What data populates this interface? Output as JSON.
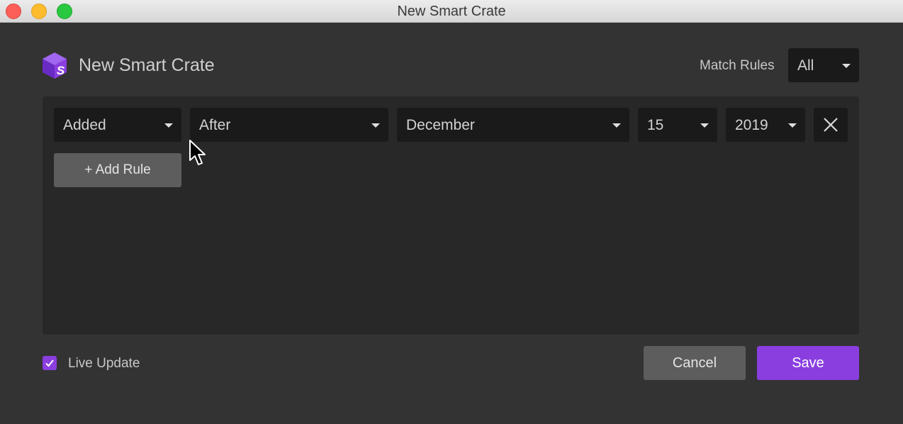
{
  "window": {
    "title": "New Smart Crate"
  },
  "header": {
    "title": "New Smart Crate",
    "logo_icon": "smart-crate-cube-icon",
    "match_rules_label": "Match Rules",
    "match_rules_value": "All"
  },
  "rule": {
    "field": "Added",
    "operator": "After",
    "month": "December",
    "day": "15",
    "year": "2019",
    "remove_icon": "close-x-icon"
  },
  "add_rule_label": "+ Add Rule",
  "footer": {
    "live_update_label": "Live Update",
    "live_update_checked": true,
    "cancel_label": "Cancel",
    "save_label": "Save"
  },
  "colors": {
    "accent": "#8a3ee0",
    "background": "#333333",
    "panel": "#282828",
    "dropdown": "#1a1a1a",
    "secondary_button": "#5d5d5d"
  }
}
